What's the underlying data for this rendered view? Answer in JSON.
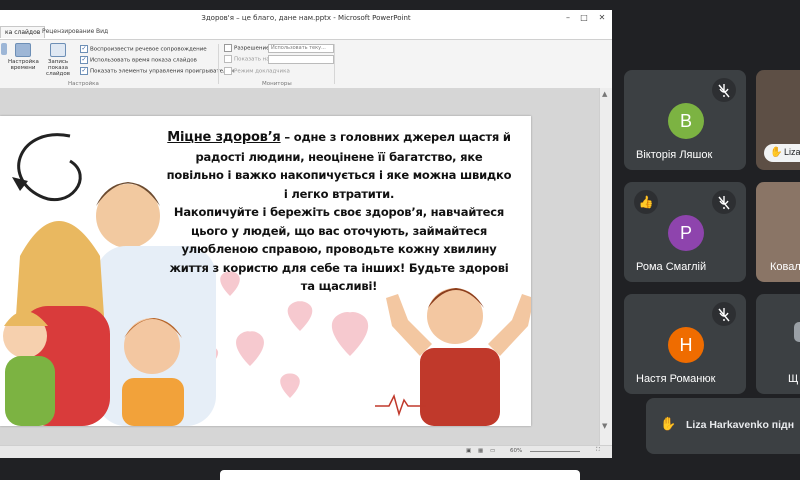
{
  "window": {
    "title": "Здоров'я – це благо, дане нам.pptx - Microsoft PowerPoint",
    "minimize_icon": "minimize-icon",
    "maximize_icon": "maximize-icon",
    "close_icon": "close-icon"
  },
  "ribbon": {
    "tabs": [
      {
        "label": "ка слайдов",
        "active": true
      },
      {
        "label": "Рецензирование",
        "active": false
      },
      {
        "label": "Вид",
        "active": false
      }
    ],
    "buttons": [
      {
        "label": "Настройка времени",
        "icon": "timing-icon"
      },
      {
        "label": "Запись показа слайдов",
        "icon": "record-icon"
      }
    ],
    "checkboxes": [
      {
        "label": "Воспроизвести речевое сопровождение",
        "checked": true
      },
      {
        "label": "Использовать время показа слайдов",
        "checked": true
      },
      {
        "label": "Показать элементы управления проигрывателем",
        "checked": true
      }
    ],
    "group_nastroika": "Настройка",
    "resolution_label": "Разрешение:",
    "resolution_value": "Использовать теку...",
    "show_on_label": "Показать на:",
    "presenter_mode": "Режим докладчика",
    "group_monitors": "Мониторы"
  },
  "slide": {
    "lead": "Міцне здоров’я",
    "paragraph1": " – одне з головних джерел щастя й радості людини, неоцінене її багатство, яке повільно і важко накопичується і яке можна швидко і легко втратити.",
    "paragraph2": "Накопичуйте і бережіть своє здоров’я, навчайтеся цього у людей, що вас оточують, займайтеся улюбленою справою, проводьте кожну хвилину життя з користю для себе та інших! Будьте здорові та щасливі!"
  },
  "status": {
    "zoom": "60%"
  },
  "participants": [
    {
      "name": "Вікторія Ляшок",
      "initial": "В",
      "color": "#7cb342",
      "muted": true
    },
    {
      "name": "Liza",
      "initial": "",
      "color": "#8d6e63",
      "muted": false
    },
    {
      "name": "Рома Смаглій",
      "initial": "Р",
      "color": "#8e44ad",
      "muted": true,
      "hand": true
    },
    {
      "name": "Ковал",
      "initial": "",
      "color": "#a1887f",
      "muted": false
    },
    {
      "name": "Настя Романюк",
      "initial": "Н",
      "color": "#ef6c00",
      "muted": true
    },
    {
      "name": "Щ",
      "initial": "",
      "color": "#3c4043",
      "muted": false
    }
  ],
  "toast": {
    "text": "Liza Harkavenko підн",
    "icon": "raised-hand-icon"
  },
  "colors": {
    "meet_bg": "#202124",
    "tile_bg": "#3c4043",
    "ppt_accent": "#2b579a"
  }
}
